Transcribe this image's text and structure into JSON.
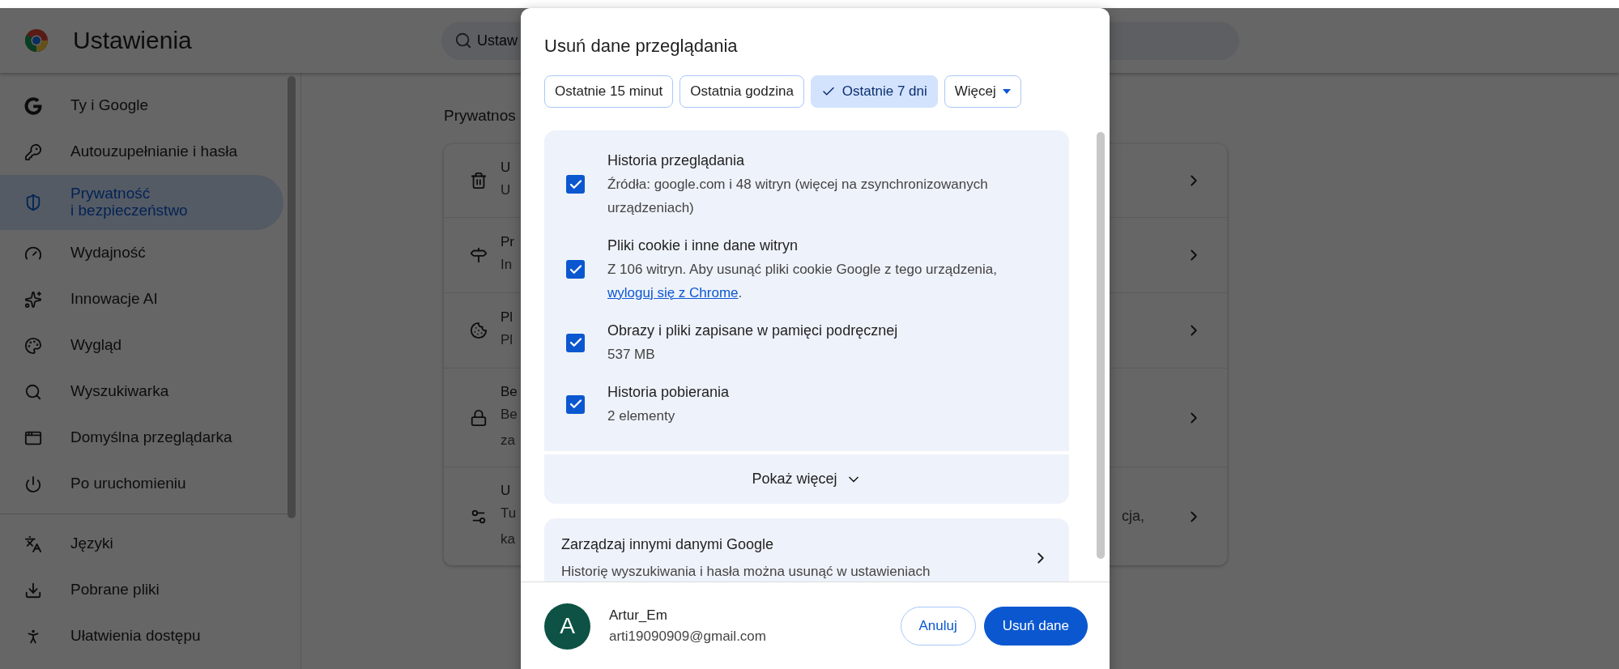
{
  "header": {
    "title": "Ustawienia",
    "search": {
      "placeholder": "Ustaw"
    }
  },
  "sidebar": {
    "sections": [
      {
        "items": [
          {
            "label": "Ty i Google",
            "selected": false
          },
          {
            "label": "Autouzupełnianie i hasła",
            "selected": false
          },
          {
            "label": "Prywatność\ni bezpieczeństwo",
            "selected": true
          },
          {
            "label": "Wydajność",
            "selected": false
          },
          {
            "label": "Innowacje AI",
            "selected": false
          },
          {
            "label": "Wygląd",
            "selected": false
          },
          {
            "label": "Wyszukiwarka",
            "selected": false
          },
          {
            "label": "Domyślna przeglądarka",
            "selected": false
          },
          {
            "label": "Po uruchomieniu",
            "selected": false
          }
        ]
      },
      {
        "items": [
          {
            "label": "Języki",
            "selected": false
          },
          {
            "label": "Pobrane pliki",
            "selected": false
          },
          {
            "label": "Ułatwienia dostępu",
            "selected": false
          }
        ]
      }
    ]
  },
  "main": {
    "section_title": "Prywatnos",
    "rows": [
      {
        "title": "U",
        "lines": [
          "U"
        ]
      },
      {
        "title": "Pr",
        "lines": [
          "In"
        ]
      },
      {
        "title": "Pl",
        "lines": [
          "Pl"
        ]
      },
      {
        "title": "Be",
        "lines": [
          "Be",
          "za"
        ]
      },
      {
        "title": "U",
        "lines": [
          "Tu",
          "ka"
        ],
        "tail": "cja,"
      }
    ]
  },
  "dialog": {
    "title": "Usuń dane przeglądania",
    "chips": [
      {
        "label": "Ostatnie 15 minut",
        "selected": false,
        "kind": "option"
      },
      {
        "label": "Ostatnia godzina",
        "selected": false,
        "kind": "option"
      },
      {
        "label": "Ostatnie 7 dni",
        "selected": true,
        "kind": "option"
      },
      {
        "label": "Więcej",
        "selected": false,
        "kind": "dropdown"
      }
    ],
    "items": [
      {
        "title": "Historia przeglądania",
        "checked": true,
        "description": "Źródła: google.com i 48 witryn (więcej na zsynchronizowanych urządzeniach)"
      },
      {
        "title": "Pliki cookie i inne dane witryn",
        "checked": true,
        "description": "Z 106 witryn. Aby usunąć pliki cookie Google z tego urządzenia, ",
        "link": "wyloguj się z Chrome",
        "after_link": "."
      },
      {
        "title": "Obrazy i pliki zapisane w pamięci podręcznej",
        "checked": true,
        "description": "537 MB"
      },
      {
        "title": "Historia pobierania",
        "checked": true,
        "description": "2 elementy"
      }
    ],
    "show_more": "Pokaż więcej",
    "manage": {
      "title": "Zarządzaj innymi danymi Google",
      "description": "Historię wyszukiwania i hasła można usunąć w ustawieniach"
    },
    "account": {
      "avatar_letter": "A",
      "name": "Artur_Em",
      "email": "arti19090909@gmail.com"
    },
    "buttons": {
      "cancel": "Anuluj",
      "confirm": "Usuń dane"
    }
  }
}
